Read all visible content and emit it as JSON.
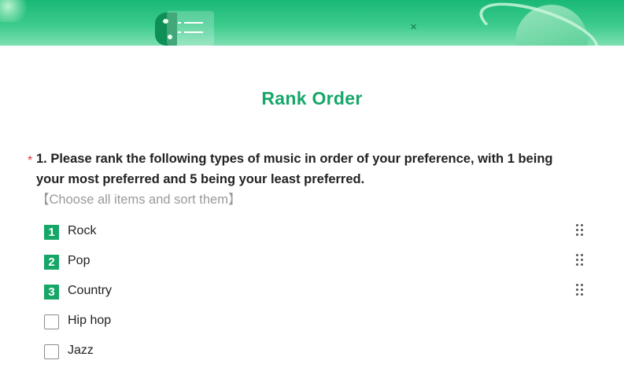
{
  "title": "Rank Order",
  "question": {
    "required_mark": "*",
    "text": "1. Please rank the following types of music in order of your preference, with 1 being your most preferred and 5 being your least preferred.",
    "hint": "【Choose all items and sort them】"
  },
  "options": [
    {
      "label": "Rock",
      "rank": "1"
    },
    {
      "label": "Pop",
      "rank": "2"
    },
    {
      "label": "Country",
      "rank": "3"
    },
    {
      "label": "Hip hop",
      "rank": ""
    },
    {
      "label": "Jazz",
      "rank": ""
    }
  ],
  "colors": {
    "accent": "#16a768",
    "required": "#e53935",
    "hint": "#9a9a9a"
  }
}
